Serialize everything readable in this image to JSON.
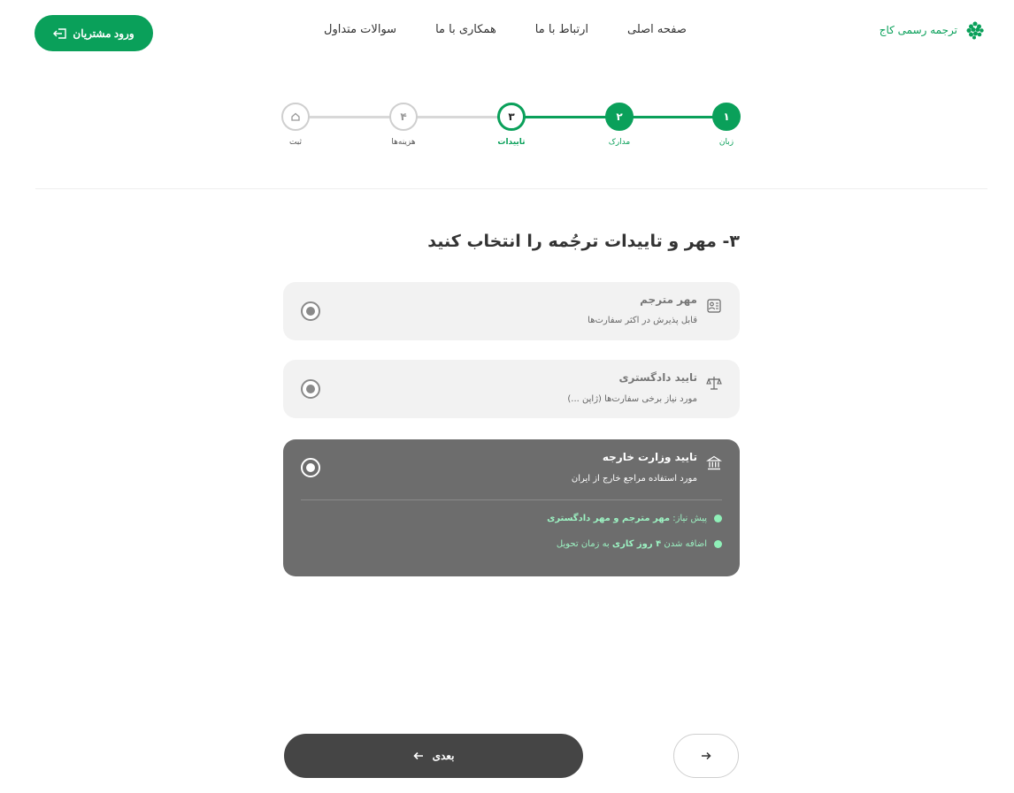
{
  "header": {
    "logo_text": "ترجمه رسمی کاج",
    "nav": [
      "صفحه اصلی",
      "ارتباط با ما",
      "همکاری با ما",
      "سوالات متداول"
    ],
    "login_label": "ورود مشتریان"
  },
  "stepper": {
    "steps": [
      {
        "number": "۱",
        "label": "زبان",
        "state": "done"
      },
      {
        "number": "۲",
        "label": "مدارک",
        "state": "done"
      },
      {
        "number": "۳",
        "label": "تاییدات",
        "state": "active"
      },
      {
        "number": "۴",
        "label": "هزینه‌ها",
        "state": "pending"
      },
      {
        "number": "",
        "label": "ثبت",
        "state": "pending"
      }
    ]
  },
  "section": {
    "title": "۳- مهر و تاییدات ترجُمه را انتخاب کنید"
  },
  "options": [
    {
      "title": "مهر مترجم",
      "subtitle": "قابل پذیرش در اکثر سفارت‌ها",
      "icon": "translator-stamp-icon",
      "selected": false
    },
    {
      "title": "تایید دادگستری",
      "subtitle": "مورد نیاز برخی سفارت‌ها (ژاپن ...)",
      "icon": "scale-icon",
      "selected": false
    },
    {
      "title": "تایید وزارت خارجه",
      "subtitle": "مورد استفاده مراجع خارج از ایران",
      "icon": "ministry-building-icon",
      "selected": true,
      "notes": [
        {
          "prefix": "پیش نیاز:",
          "bold": "مهر مترجم و مهر دادگستری",
          "suffix": ""
        },
        {
          "prefix": "اضافه شدن",
          "bold": "۴ روز کاری",
          "suffix": "به زمان تحویل"
        }
      ]
    }
  ],
  "footer": {
    "next_label": "بعدی"
  },
  "colors": {
    "brand": "#0aa05a",
    "selected_card": "#6d6d6d",
    "note_text": "#9cf2c2",
    "next_button": "#454545"
  }
}
